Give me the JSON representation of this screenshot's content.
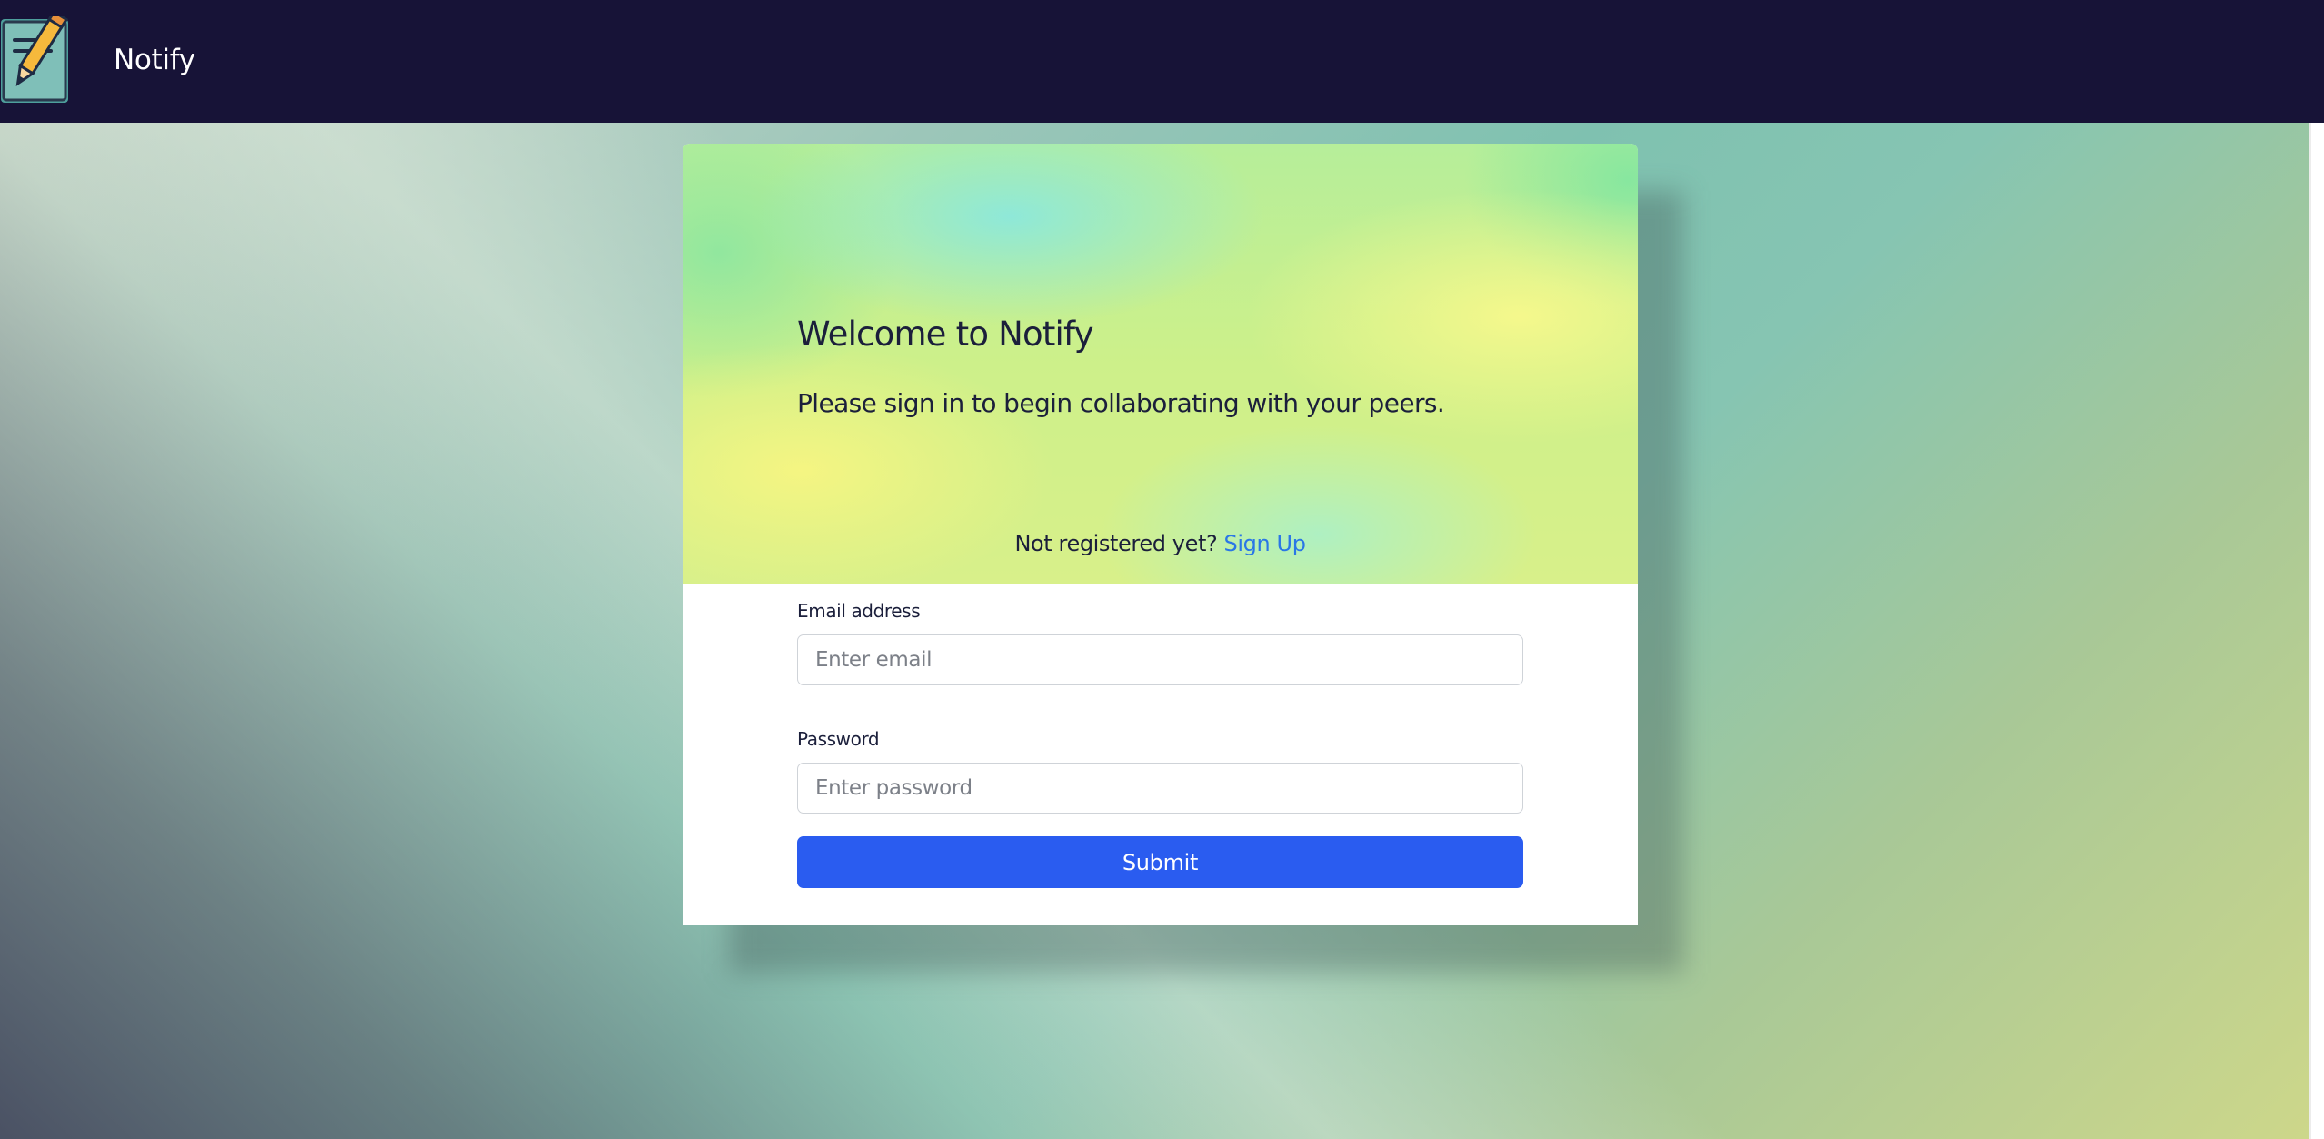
{
  "navbar": {
    "brand": "Notify",
    "logo_icon": "notepad-pencil-icon"
  },
  "hero": {
    "title": "Welcome to Notify",
    "subtitle": "Please sign in to begin collaborating with your peers.",
    "register_prompt": "Not registered yet?",
    "register_link": "Sign Up"
  },
  "form": {
    "email_label": "Email address",
    "email_placeholder": "Enter email",
    "email_value": "",
    "password_label": "Password",
    "password_placeholder": "Enter password",
    "password_value": "",
    "submit_label": "Submit"
  },
  "colors": {
    "navbar_bg": "#171337",
    "primary": "#2a5cf0",
    "link": "#2a77e6",
    "text_dark": "#1b1f3b"
  }
}
